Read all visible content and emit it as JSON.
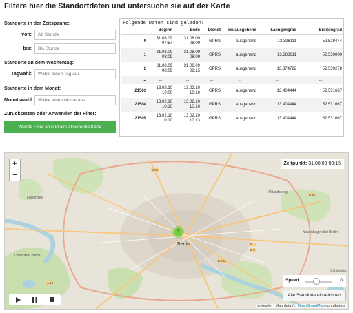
{
  "page_title": "Filtere hier die Standortdaten und untersuche sie auf der Karte",
  "filters": {
    "time_section": "Standorte in der Zeitspanne:",
    "from_label": "von:",
    "from_placeholder": "Ab Stunde",
    "to_label": "bis:",
    "to_placeholder": "Bis Stunde",
    "weekday_section": "Standorte an dem Wochentag:",
    "weekday_label": "Tagwahl:",
    "weekday_placeholder": "Wähle einen Tag aus",
    "month_section": "Standorte in dem Monat:",
    "month_label": "Monatswahl:",
    "month_placeholder": "Wähle einen Monat aus",
    "reset_section": "Zurücksetzen oder Anwenden der Filter:",
    "apply_button": "Wende Filter an und aktualisiere die Karte"
  },
  "table": {
    "caption": "Folgende Daten sind geladen:",
    "columns": [
      "",
      "Beginn",
      "Ende",
      "Dienst",
      "ein/ausgehend",
      "Laengengrad",
      "Breitengrad"
    ],
    "rows": [
      {
        "idx": "0",
        "beginn_d": "31.08.09",
        "beginn_t": "07:57",
        "ende_d": "31.08.09",
        "ende_t": "08:09",
        "dienst": "GPRS",
        "richtung": "ausgehend",
        "laenge": "13.396111",
        "breite": "52.529444"
      },
      {
        "idx": "1",
        "beginn_d": "31.08.09",
        "beginn_t": "08:09",
        "ende_d": "31.08.09",
        "ende_t": "08:09",
        "dienst": "GPRS",
        "richtung": "ausgehend",
        "laenge": "13.383611",
        "breite": "52.530000"
      },
      {
        "idx": "2",
        "beginn_d": "31.08.09",
        "beginn_t": "08:09",
        "ende_d": "31.08.09",
        "ende_t": "08:15",
        "dienst": "GPRS",
        "richtung": "ausgehend",
        "laenge": "13.374722",
        "breite": "52.530278"
      },
      {
        "idx": "21503",
        "beginn_d": "13.02.10",
        "beginn_t": "10:00",
        "ende_d": "13.02.10",
        "ende_t": "10:10",
        "dienst": "GPRS",
        "richtung": "ausgehend",
        "laenge": "13.404444",
        "breite": "52.531667"
      },
      {
        "idx": "21504",
        "beginn_d": "13.02.10",
        "beginn_t": "10:10",
        "ende_d": "13.02.10",
        "ende_t": "10:10",
        "dienst": "GPRS",
        "richtung": "ausgehend",
        "laenge": "13.404444",
        "breite": "52.531667"
      },
      {
        "idx": "21505",
        "beginn_d": "13.02.10",
        "beginn_t": "10:10",
        "ende_d": "13.02.10",
        "ende_t": "10:13",
        "dienst": "GPRS",
        "richtung": "ausgehend",
        "laenge": "13.404444",
        "breite": "52.531667"
      }
    ],
    "ellipsis": "..."
  },
  "map": {
    "zoom_in": "+",
    "zoom_out": "−",
    "time_label": "Zeitpunkt:",
    "time_value": "31.08.09 08:15",
    "cluster_count": "3",
    "city": "Berlin",
    "speed_label": "Speed",
    "speed_value": "10",
    "all_button": "Alle Standorte einzeichnen",
    "play_icon": "play-icon",
    "pause_icon": "pause-icon",
    "stop_icon": "stop-icon",
    "attribution_prefix": "ipyleaflet | Map data (c) ",
    "attribution_link": "OpenStreetMap",
    "attribution_suffix": " contributors",
    "labels": [
      "Falkensee",
      "Altlandsberg",
      "Neuenhagen bei Berlin",
      "Döberitzer Heide",
      "Schönefeld"
    ],
    "road_tags": [
      "B 96",
      "A 10",
      "B 5",
      "B 1",
      "B 96a",
      "A 10"
    ],
    "colors": {
      "land": "#e7e2d9",
      "park": "#c8dfb0",
      "water": "#aad3df",
      "urban": "#ddd6cc",
      "road_major": "#f6c780",
      "cluster": "#6ecc39"
    }
  }
}
